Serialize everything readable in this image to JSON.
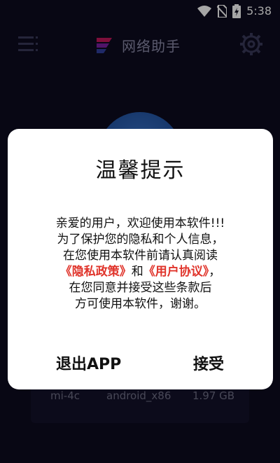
{
  "status_bar": {
    "time": "5:38",
    "icons": [
      "wifi-icon",
      "no-sim-icon",
      "battery-charging-icon"
    ]
  },
  "header": {
    "title": "网络助手",
    "menu_icon": "menu-icon",
    "settings_icon": "gear-icon"
  },
  "device_info": {
    "model": "mi-4c",
    "arch": "android_x86",
    "storage": "1.97 GB"
  },
  "dialog": {
    "title": "温馨提示",
    "lines": [
      "亲爱的用户，欢迎使用本软件!!!",
      "为了保护您的隐私和个人信息，",
      "在您使用本软件前请认真阅读"
    ],
    "privacy_policy": "《隐私政策》",
    "conjunction": "和",
    "user_agreement": "《用户协议》",
    "trailing_comma": "，",
    "line_after": "在您同意并接受这些条款后",
    "line_last": "方可使用本软件，谢谢。",
    "exit_label": "退出APP",
    "accept_label": "接受",
    "link_color": "#e0342b"
  }
}
